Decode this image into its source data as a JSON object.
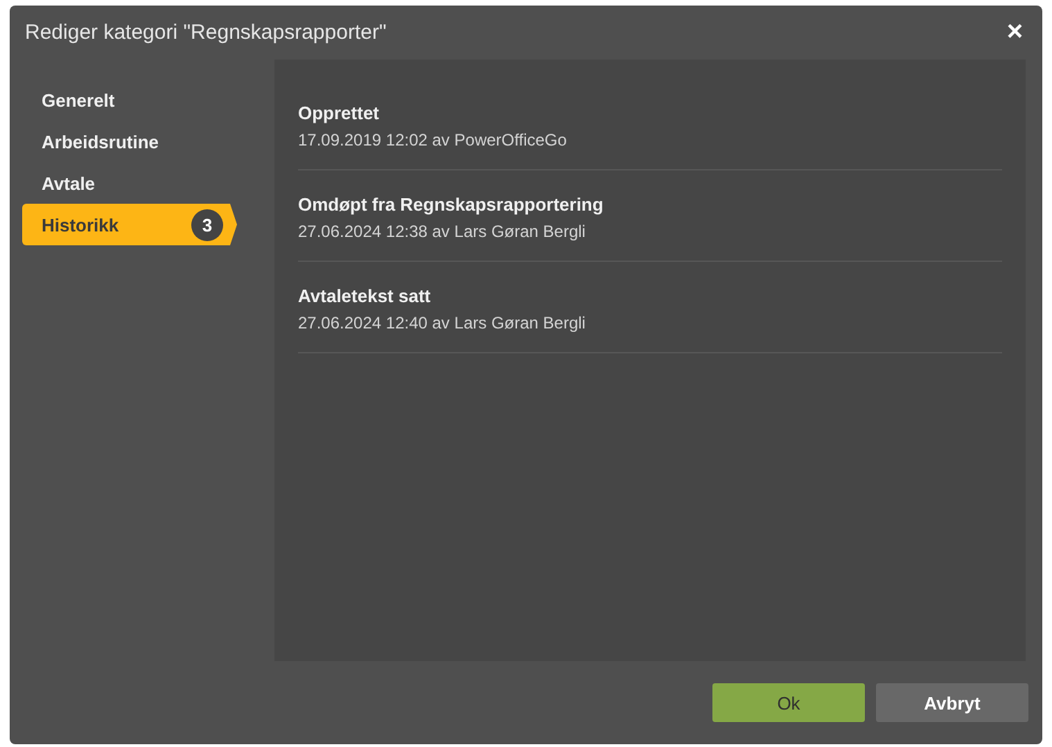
{
  "dialog": {
    "title": "Rediger kategori \"Regnskapsrapporter\"",
    "close": "×"
  },
  "sidebar": {
    "items": [
      {
        "label": "Generelt",
        "selected": false
      },
      {
        "label": "Arbeidsrutine",
        "selected": false
      },
      {
        "label": "Avtale",
        "selected": false
      },
      {
        "label": "Historikk",
        "selected": true,
        "badge": "3"
      }
    ]
  },
  "history": [
    {
      "title": "Opprettet",
      "detail": "17.09.2019 12:02 av PowerOfficeGo"
    },
    {
      "title": "Omdøpt fra Regnskapsrapportering",
      "detail": "27.06.2024 12:38 av Lars Gøran Bergli"
    },
    {
      "title": "Avtaletekst satt",
      "detail": "27.06.2024 12:40 av Lars Gøran Bergli"
    }
  ],
  "buttons": [
    {
      "label": "Ok",
      "kind": "primary"
    },
    {
      "label": "Avbryt",
      "kind": "secondary"
    }
  ]
}
